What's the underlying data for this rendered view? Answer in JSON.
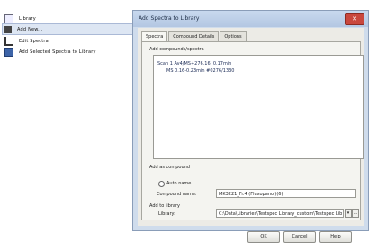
{
  "menu": {
    "items": [
      {
        "label": "Library",
        "icon": "library-icon"
      },
      {
        "label": "Add New...",
        "icon": "add-new-icon",
        "selected": true
      },
      {
        "label": "Edit Spectra",
        "icon": "edit-icon"
      },
      {
        "label": "Add Selected Spectra to Library",
        "icon": "list-icon"
      }
    ]
  },
  "dialog": {
    "title": "Add Spectra to Library",
    "tabs": [
      "Spectra",
      "Compound Details",
      "Options"
    ],
    "compounds_group_label": "Add compounds/spectra",
    "tree": [
      "Scan 1 Av4/MS+276.16, 0.17min",
      "MS 0.16-0.23min #0276/1330"
    ],
    "add_as_compound_label": "Add as compound",
    "auto_name_label": "Auto name",
    "compound_name_label": "Compound name:",
    "compound_name_value": "MK3221_Fr.4 (Fluxopanol)(6)",
    "add_to_library_label": "Add to library",
    "library_label": "Library:",
    "library_value": "C:\\Data\\Libraries\\Testspec Library_custom\\Testspec Lib",
    "buttons": {
      "ok": "OK",
      "cancel": "Cancel",
      "help": "Help"
    }
  }
}
